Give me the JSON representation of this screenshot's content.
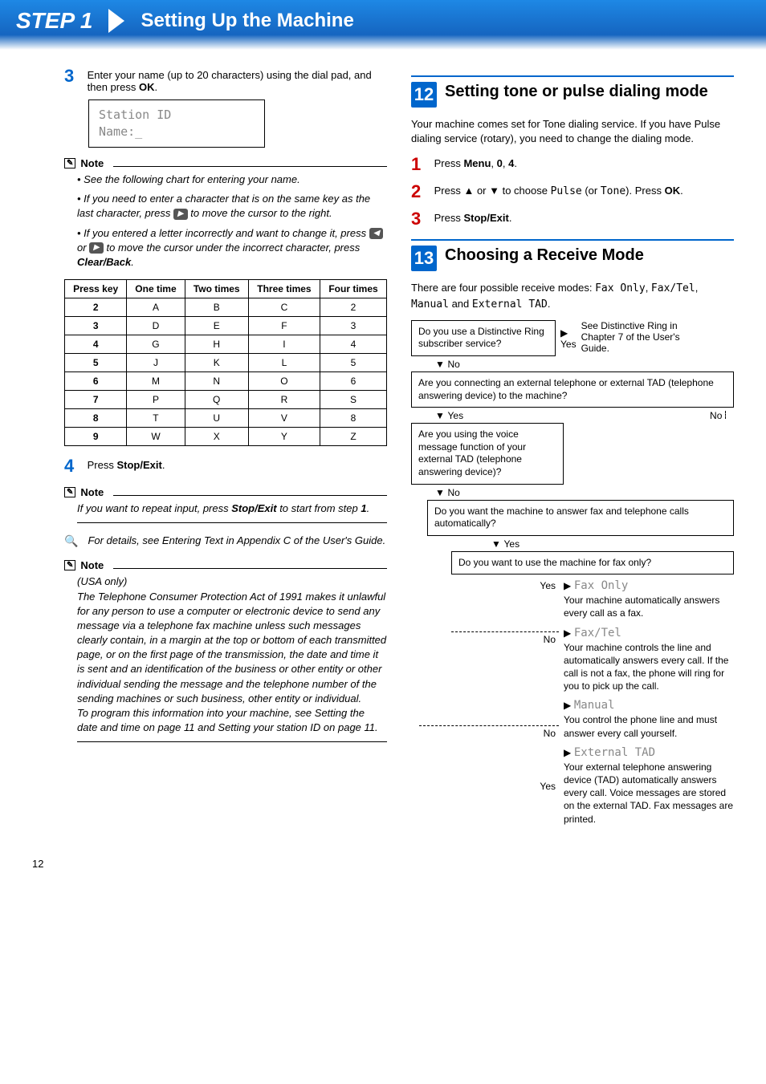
{
  "header": {
    "step": "STEP 1",
    "title": "Setting Up the Machine"
  },
  "left": {
    "step3": {
      "num": "3",
      "text_a": "Enter your name (up to 20 characters) using the dial pad, and then press ",
      "ok": "OK",
      "text_b": "."
    },
    "lcd": {
      "line1": "Station ID",
      "line2": "Name:_"
    },
    "note1": {
      "label": "Note",
      "b1": "See the following chart for entering your name.",
      "b2_a": "If you need to enter a character that is on the same key as the last character, press ",
      "b2_b": " to move the cursor to the right.",
      "b3_a": "If you entered a letter incorrectly and want to change it, press ",
      "b3_or": " or ",
      "b3_b": " to move the cursor under the incorrect character, press ",
      "b3_clear": "Clear/Back",
      "b3_c": "."
    },
    "nav_left": "◀",
    "nav_right": "▶",
    "table": {
      "headers": [
        "Press key",
        "One time",
        "Two times",
        "Three times",
        "Four times"
      ],
      "rows": [
        [
          "2",
          "A",
          "B",
          "C",
          "2"
        ],
        [
          "3",
          "D",
          "E",
          "F",
          "3"
        ],
        [
          "4",
          "G",
          "H",
          "I",
          "4"
        ],
        [
          "5",
          "J",
          "K",
          "L",
          "5"
        ],
        [
          "6",
          "M",
          "N",
          "O",
          "6"
        ],
        [
          "7",
          "P",
          "Q",
          "R",
          "S"
        ],
        [
          "8",
          "T",
          "U",
          "V",
          "8"
        ],
        [
          "9",
          "W",
          "X",
          "Y",
          "Z"
        ]
      ]
    },
    "step4": {
      "num": "4",
      "text_a": "Press ",
      "stop": "Stop/Exit",
      "text_b": "."
    },
    "note2": {
      "label": "Note",
      "text_a": "If you want to repeat input, press ",
      "stop": "Stop/Exit",
      "text_b": " to start from step ",
      "one": "1",
      "text_c": "."
    },
    "tip": "For details, see Entering Text in Appendix C of the User's Guide.",
    "note3": {
      "label": "Note",
      "usa": "(USA only)",
      "body": "The Telephone Consumer Protection Act of 1991 makes it unlawful for any person to use a computer or electronic device to send any message via a telephone fax machine unless such messages clearly contain, in a margin at the top or bottom of each transmitted page, or on the first page of the transmission, the date and time it is sent and an identification of the business or other entity or other individual sending the message and the telephone number of the sending machines or such business, other entity or individual.\nTo program this information into your machine, see Setting the date and time on page 11 and Setting your station ID on page 11."
    }
  },
  "right": {
    "sec12": {
      "num": "12",
      "title": "Setting tone or pulse dialing mode"
    },
    "sec12_intro": "Your machine comes set for Tone dialing service. If you have Pulse dialing service (rotary), you need to change the dialing mode.",
    "s12_1": {
      "num": "1",
      "a": "Press ",
      "menu": "Menu",
      "b": ", ",
      "zero": "0",
      "c": ", ",
      "four": "4",
      "d": "."
    },
    "s12_2": {
      "num": "2",
      "a": "Press ▲ or ▼ to choose ",
      "pulse": "Pulse",
      "b": " (or ",
      "tone": "Tone",
      "c": "). Press ",
      "ok": "OK",
      "d": "."
    },
    "s12_3": {
      "num": "3",
      "a": "Press ",
      "stop": "Stop/Exit",
      "b": "."
    },
    "sec13": {
      "num": "13",
      "title": "Choosing a Receive Mode"
    },
    "sec13_intro_a": "There are four possible receive modes: ",
    "sec13_modes": {
      "fo": "Fax Only",
      "ft": "Fax/Tel",
      "m": "Manual",
      "et": "External TAD"
    },
    "sec13_intro_b": " and ",
    "flow": {
      "q1": "Do you use a Distinctive Ring subscriber service?",
      "q1_yes": "Yes",
      "q1_no": "No",
      "q1_ref": "See Distinctive Ring in Chapter 7 of the User's Guide.",
      "q2": "Are you connecting an external telephone or external TAD (telephone answering device) to the machine?",
      "q2_yes": "Yes",
      "q2_no": "No",
      "q3": "Are you using the voice message function of your external TAD (telephone answering device)?",
      "q3_no": "No",
      "q4": "Do you want the machine to answer fax and telephone calls automatically?",
      "q4_yes": "Yes",
      "q5": "Do you want to use the machine for fax only?",
      "q5_yes": "Yes",
      "q5_no": "No",
      "m_faxonly": {
        "title": "Fax Only",
        "desc": "Your machine automatically answers every call as a fax."
      },
      "m_faxtel": {
        "title": "Fax/Tel",
        "desc": "Your machine controls the line and automatically answers every call. If the call is not a fax, the phone will ring for you to pick up the call."
      },
      "m_manual": {
        "title": "Manual",
        "desc": "You control the phone line and must answer every call yourself."
      },
      "m_external": {
        "title": "External TAD",
        "desc": "Your external telephone answering device (TAD) automatically answers every call. Voice messages are stored on the external TAD. Fax messages are printed."
      },
      "q4_no": "No",
      "q3_yes_label": "Yes"
    }
  },
  "page_num": "12"
}
